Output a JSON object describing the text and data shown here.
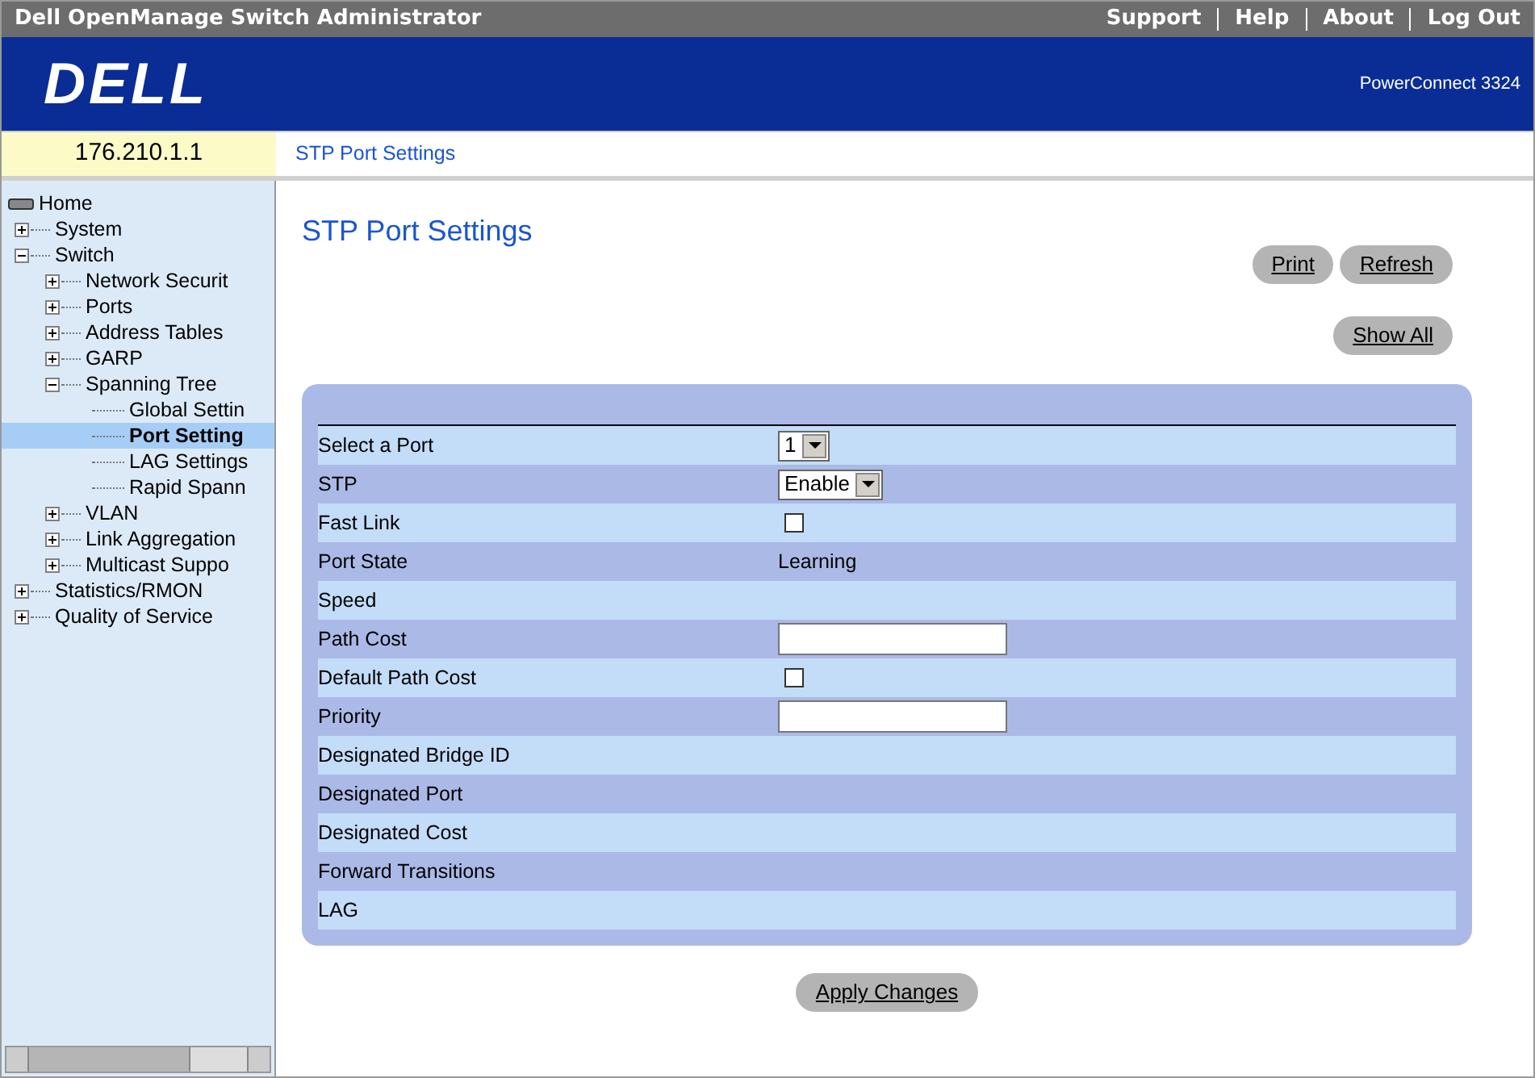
{
  "title_bar": {
    "title": "Dell OpenManage Switch Administrator",
    "links": [
      "Support",
      "Help",
      "About",
      "Log Out"
    ]
  },
  "header": {
    "logo": "DELL",
    "model": "PowerConnect 3324"
  },
  "address": "176.210.1.1",
  "breadcrumb": "STP Port Settings",
  "tree": [
    {
      "label": "Home",
      "kind": "root",
      "selected": false,
      "children": [
        {
          "label": "System",
          "expanded": false,
          "selected": false
        },
        {
          "label": "Switch",
          "expanded": true,
          "selected": false,
          "children": [
            {
              "label": "Network Securit",
              "expanded": false,
              "selected": false
            },
            {
              "label": "Ports",
              "expanded": false,
              "selected": false
            },
            {
              "label": "Address Tables",
              "expanded": false,
              "selected": false
            },
            {
              "label": "GARP",
              "expanded": false,
              "selected": false
            },
            {
              "label": "Spanning Tree",
              "expanded": true,
              "selected": false,
              "children": [
                {
                  "label": "Global Settin",
                  "kind": "leaf",
                  "selected": false
                },
                {
                  "label": "Port Setting",
                  "kind": "leaf",
                  "selected": true
                },
                {
                  "label": "LAG Settings",
                  "kind": "leaf",
                  "selected": false
                },
                {
                  "label": "Rapid Spann",
                  "kind": "leaf",
                  "selected": false
                }
              ]
            },
            {
              "label": "VLAN",
              "expanded": false,
              "selected": false
            },
            {
              "label": "Link Aggregation",
              "expanded": false,
              "selected": false
            },
            {
              "label": "Multicast Suppo",
              "expanded": false,
              "selected": false
            }
          ]
        },
        {
          "label": "Statistics/RMON",
          "expanded": false,
          "selected": false
        },
        {
          "label": "Quality of Service",
          "expanded": false,
          "selected": false
        }
      ]
    }
  ],
  "page_title": "STP Port Settings",
  "top_buttons": [
    "Print",
    "Refresh"
  ],
  "show_all": "Show All",
  "rows": [
    {
      "label": "Select a Port",
      "kind": "select",
      "value": "1"
    },
    {
      "label": "STP",
      "kind": "select",
      "value": "Enable"
    },
    {
      "label": "Fast Link",
      "kind": "checkbox",
      "checked": false
    },
    {
      "label": "Port State",
      "kind": "text",
      "value": "Learning"
    },
    {
      "label": "Speed",
      "kind": "empty"
    },
    {
      "label": "Path Cost",
      "kind": "input"
    },
    {
      "label": "Default Path Cost",
      "kind": "checkbox",
      "checked": false
    },
    {
      "label": "Priority",
      "kind": "input"
    },
    {
      "label": "Designated Bridge ID",
      "kind": "empty"
    },
    {
      "label": "Designated Port",
      "kind": "empty"
    },
    {
      "label": "Designated Cost",
      "kind": "empty"
    },
    {
      "label": "Forward Transitions",
      "kind": "empty"
    },
    {
      "label": "LAG",
      "kind": "empty"
    }
  ],
  "apply": "Apply Changes"
}
